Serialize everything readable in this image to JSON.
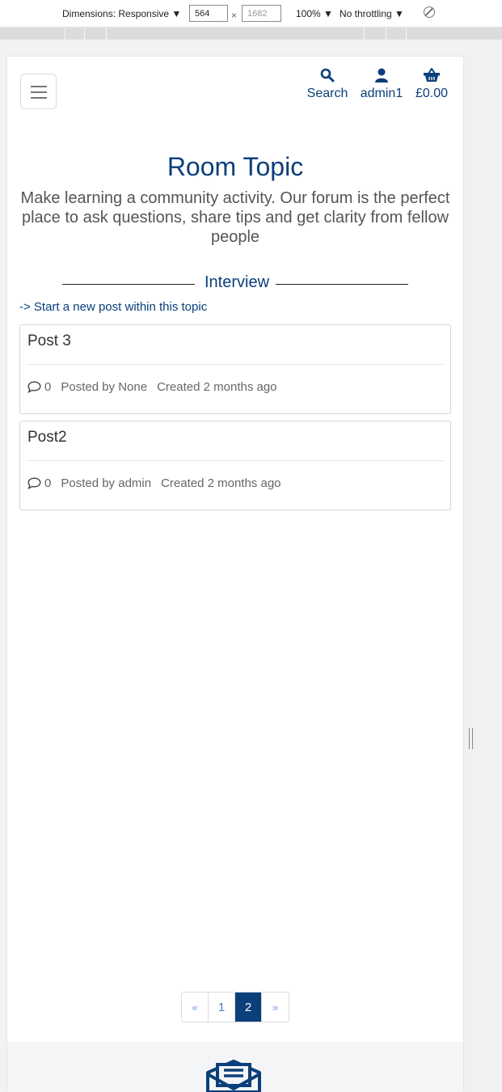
{
  "devtools": {
    "dimensions_label": "Dimensions: Responsive ▼",
    "width_value": "564",
    "times": "×",
    "height_value": "1682",
    "zoom": "100% ▼",
    "throttling": "No throttling ▼"
  },
  "nav": {
    "search_label": "Search",
    "user_label": "admin1",
    "cart_label": "£0.00"
  },
  "page": {
    "title": "Room Topic",
    "subtitle": "Make learning a community activity. Our forum is the perfect place to ask questions, share tips and get clarity from fellow people",
    "topic_divider": "Interview",
    "new_post_link": "-> Start a new post within this topic"
  },
  "posts": [
    {
      "title": "Post 3",
      "comments": "0",
      "posted_by": "Posted by None",
      "created": "Created 2 months ago"
    },
    {
      "title": "Post2",
      "comments": "0",
      "posted_by": "Posted by admin",
      "created": "Created 2 months ago"
    }
  ],
  "pagination": {
    "prev": "«",
    "pages": [
      "1",
      "2"
    ],
    "active": "2",
    "next": "»"
  },
  "colors": {
    "brand": "#0b3f7a",
    "link_light": "#4a7bbf"
  },
  "icons": {
    "search": "search-icon",
    "user": "user-icon",
    "cart": "basket-icon",
    "menu": "hamburger-icon",
    "comment": "comment-icon",
    "newsletter": "envelope-open-icon"
  }
}
